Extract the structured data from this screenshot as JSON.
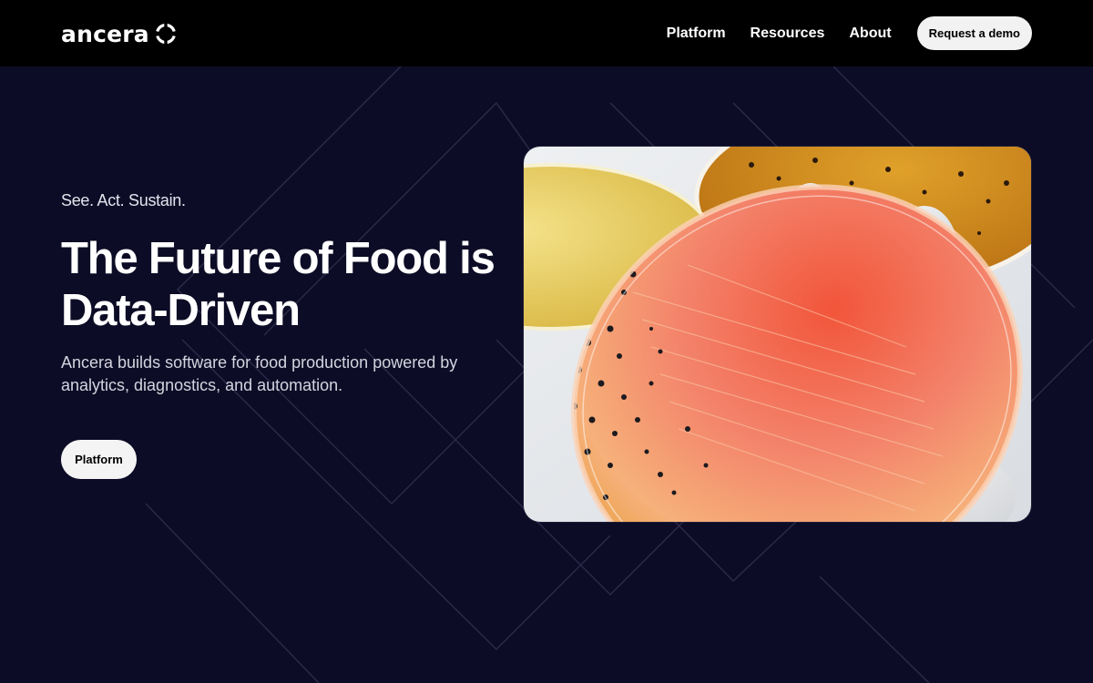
{
  "header": {
    "logo_text": "ancera",
    "nav": [
      {
        "label": "Platform"
      },
      {
        "label": "Resources"
      },
      {
        "label": "About"
      }
    ],
    "cta_label": "Request a demo"
  },
  "hero": {
    "tagline": "See. Act. Sustain.",
    "headline": "The Future of Food is Data-Driven",
    "description": "Ancera builds software for food production powered by analytics, diagnostics, and automation.",
    "button_label": "Platform",
    "image_subject": "petri-dish-bacterial-culture"
  },
  "colors": {
    "background": "#0d0c26",
    "topbar": "#000000",
    "button_bg": "#f4f4f4",
    "text": "#ffffff"
  }
}
